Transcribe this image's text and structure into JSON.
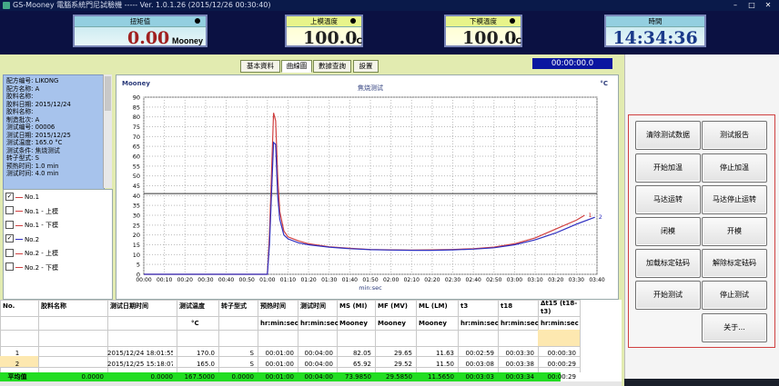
{
  "window": {
    "title": "GS-Mooney 電腦系統門尼試驗機 ----- Ver. 1.0.1.26 (2015/12/26 00:30:40)"
  },
  "gauges": {
    "viscosity": {
      "label": "扭矩值",
      "value": "0.00",
      "unit": "Mooney"
    },
    "upper": {
      "label": "上模溫度",
      "value": "100.0",
      "unit": "°C"
    },
    "lower": {
      "label": "下模溫度",
      "value": "100.0",
      "unit": "°C"
    },
    "time": {
      "label": "時間",
      "value": "14:34:36"
    }
  },
  "tabs": [
    "基本資料",
    "曲線圖",
    "數據查詢",
    "設置"
  ],
  "active_tab": "曲線圖",
  "timer": "00:00:00.0",
  "info_lines": [
    "配方编号: LIKONG",
    "配方名称: A",
    "胶料名称:",
    "胶料日期: 2015/12/24",
    "胶料名称:",
    "制造批次: A",
    "测试编号: 00006",
    "测试日期: 2015/12/25",
    "测试温度: 165.0 °C",
    "测试条件: 焦烧测试",
    "转子型式: S",
    "预热时间: 1.0 min",
    "测试时间: 4.0 min"
  ],
  "legend": [
    {
      "label": "No.1",
      "checked": true,
      "color": "#d04040"
    },
    {
      "label": "No.1 - 上模",
      "checked": false,
      "color": "#d04040"
    },
    {
      "label": "No.1 - 下模",
      "checked": false,
      "color": "#d04040"
    },
    {
      "label": "No.2",
      "checked": true,
      "color": "#3030c0"
    },
    {
      "label": "No.2 - 上模",
      "checked": false,
      "color": "#d04040"
    },
    {
      "label": "No.2 - 下模",
      "checked": false,
      "color": "#d04040"
    }
  ],
  "buttons": [
    "清除测试数据",
    "测试报告",
    "开始加温",
    "停止加温",
    "马达运转",
    "马达停止运转",
    "闭模",
    "开模",
    "加载标定砝码",
    "解除标定砝码",
    "开始测试",
    "停止测试",
    "关于..."
  ],
  "chart_data": {
    "type": "line",
    "title": "焦烧测试",
    "ylabel_left": "Mooney",
    "ylabel_right": "°C",
    "xlabel": "min:sec",
    "ylim": [
      0,
      90
    ],
    "yticks": [
      0,
      5,
      10,
      15,
      20,
      25,
      30,
      35,
      40,
      45,
      50,
      55,
      60,
      65,
      70,
      75,
      80,
      85,
      90
    ],
    "xticks": [
      "00:00",
      "00:10",
      "00:20",
      "00:30",
      "00:40",
      "00:50",
      "01:00",
      "01:10",
      "01:20",
      "01:30",
      "01:40",
      "01:50",
      "02:00",
      "02:10",
      "02:20",
      "02:30",
      "02:40",
      "02:50",
      "03:00",
      "03:10",
      "03:20",
      "03:30",
      "03:40"
    ],
    "xlim_sec": [
      0,
      220
    ],
    "grid": true,
    "reference_line": {
      "y": 41,
      "color": "#333333"
    },
    "series": [
      {
        "name": "1",
        "color": "#d04040",
        "points": [
          [
            0,
            0
          ],
          [
            60,
            0
          ],
          [
            61,
            20
          ],
          [
            63,
            82
          ],
          [
            64,
            78
          ],
          [
            65,
            50
          ],
          [
            66,
            32
          ],
          [
            68,
            22
          ],
          [
            70,
            19
          ],
          [
            75,
            17
          ],
          [
            80,
            15.5
          ],
          [
            90,
            14
          ],
          [
            100,
            13.2
          ],
          [
            110,
            12.6
          ],
          [
            120,
            12.4
          ],
          [
            130,
            12.3
          ],
          [
            140,
            12.4
          ],
          [
            150,
            12.6
          ],
          [
            160,
            13
          ],
          [
            170,
            13.8
          ],
          [
            180,
            15.5
          ],
          [
            190,
            18.5
          ],
          [
            200,
            23
          ],
          [
            210,
            27.5
          ],
          [
            214,
            30
          ]
        ]
      },
      {
        "name": "2",
        "color": "#3030c0",
        "points": [
          [
            0,
            0
          ],
          [
            60,
            0
          ],
          [
            61,
            15
          ],
          [
            63,
            67
          ],
          [
            64,
            66
          ],
          [
            65,
            40
          ],
          [
            66,
            28
          ],
          [
            68,
            20
          ],
          [
            70,
            18
          ],
          [
            75,
            16
          ],
          [
            80,
            15
          ],
          [
            90,
            13.8
          ],
          [
            100,
            13
          ],
          [
            110,
            12.5
          ],
          [
            120,
            12.3
          ],
          [
            130,
            12.2
          ],
          [
            140,
            12.2
          ],
          [
            150,
            12.4
          ],
          [
            160,
            12.8
          ],
          [
            170,
            13.5
          ],
          [
            180,
            15
          ],
          [
            190,
            17.5
          ],
          [
            200,
            21
          ],
          [
            210,
            25.5
          ],
          [
            219,
            29
          ]
        ]
      }
    ]
  },
  "table": {
    "headers": [
      "No.",
      "胶料名称",
      "测试日期时间",
      "测试温度",
      "转子型式",
      "预热时间",
      "测试时间",
      "MS (MI)",
      "MF (MV)",
      "ML (LM)",
      "t3",
      "t18",
      "Δt15 (t18-t3)"
    ],
    "subheaders": [
      "",
      "",
      "",
      "°C",
      "",
      "hr:min:sec",
      "hr:min:sec",
      "Mooney",
      "Mooney",
      "Mooney",
      "hr:min:sec",
      "hr:min:sec",
      "hr:min:sec"
    ],
    "rows": [
      [
        "1",
        "",
        "2015/12/24 18:01:55",
        "170.0",
        "S",
        "00:01:00",
        "00:04:00",
        "82.05",
        "29.65",
        "11.63",
        "00:02:59",
        "00:03:30",
        "00:00:30"
      ],
      [
        "2",
        "",
        "2015/12/25 15:18:07",
        "165.0",
        "S",
        "00:01:00",
        "00:04:00",
        "65.92",
        "29.52",
        "11.50",
        "00:03:08",
        "00:03:38",
        "00:00:29"
      ]
    ],
    "average": [
      "平均值",
      "0.0000",
      "0.0000",
      "167.5000",
      "0.0000",
      "00:01:00",
      "00:04:00",
      "73.9850",
      "29.5850",
      "11.5650",
      "00:03:03",
      "00:03:34",
      "00:00:29"
    ]
  }
}
